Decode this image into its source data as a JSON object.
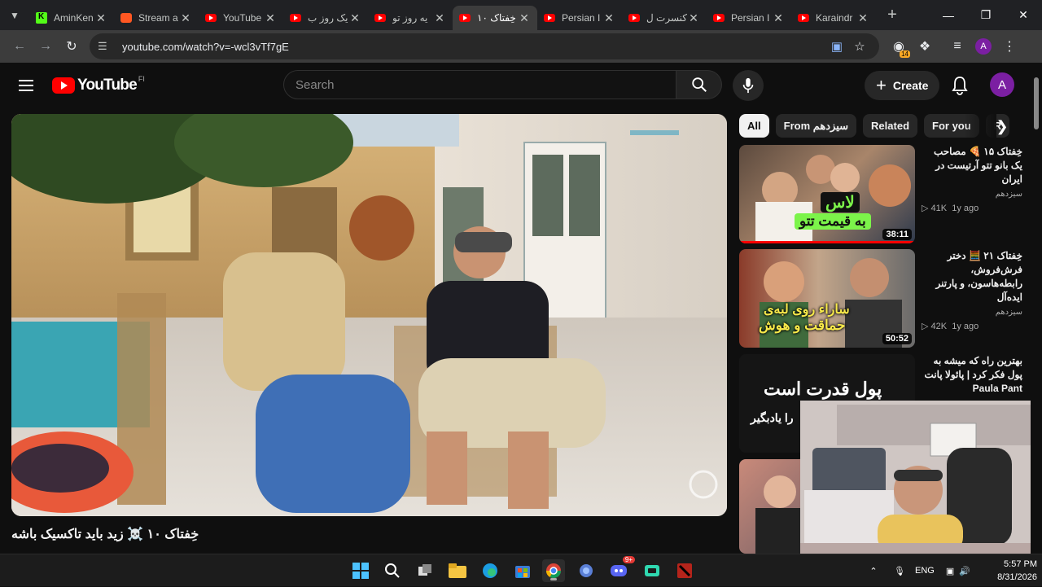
{
  "browser": {
    "tabs": [
      {
        "title": "AminKen",
        "favicon": "kick-icon",
        "active": false
      },
      {
        "title": "Stream a",
        "favicon": "stream-icon",
        "active": false
      },
      {
        "title": "YouTube",
        "favicon": "youtube-icon",
        "active": false
      },
      {
        "title": "یک روز ب",
        "favicon": "youtube-icon",
        "active": false
      },
      {
        "title": "یه روز تو",
        "favicon": "youtube-icon",
        "active": false
      },
      {
        "title": "خِفتاک ۱۰",
        "favicon": "youtube-icon",
        "active": true
      },
      {
        "title": "Persian I",
        "favicon": "youtube-icon",
        "active": false
      },
      {
        "title": "کنسرت ل",
        "favicon": "youtube-icon",
        "active": false
      },
      {
        "title": "Persian I",
        "favicon": "youtube-icon",
        "active": false
      },
      {
        "title": "Karaindr",
        "favicon": "youtube-icon",
        "active": false
      }
    ],
    "url": "youtube.com/watch?v=-wcl3vTf7gE",
    "extension_badge": "14",
    "profile_initial": "A"
  },
  "youtube": {
    "logo_text": "YouTube",
    "country_code": "FI",
    "search_placeholder": "Search",
    "create_label": "Create",
    "avatar_initial": "A",
    "video_title": "خِفتاک ۱۰ ☠️ زید باید تاکسیک باشه",
    "chips": [
      "All",
      "From سیزدهم",
      "Related",
      "For you",
      "R"
    ],
    "recommendations": [
      {
        "title": "خِفتاک ۱۵ 🍕 مصاحب یک بانو تتو آرتیست در ایران",
        "channel": "سیزدهم",
        "views": "41K",
        "age": "1y ago",
        "duration": "38:11",
        "thumb_text_1": "لاس",
        "thumb_text_2": "به قیمت تتو"
      },
      {
        "title": "خِفتاک ۲۱ 🧮 دختر فرش‌فروش، رابطه‌هاسون، و پارتنر ایده‌آل",
        "channel": "سیزدهم",
        "views": "42K",
        "age": "1y ago",
        "duration": "50:52",
        "thumb_text_1": "ساراء روی لبه‌ی",
        "thumb_text_2": "حماقت و هوش"
      },
      {
        "title": "بهترین راه که میشه به پول فکر کرد | پائولا پانت Paula Pant",
        "channel": "",
        "views": "",
        "age": "",
        "duration": "",
        "thumb_text_1": "پول قدرت است",
        "thumb_text_2": "را یادبگیر"
      }
    ]
  },
  "taskbar": {
    "language": "ENG",
    "time": "5:57 PM",
    "date": "8/31/2026",
    "discord_badge": "9+"
  }
}
